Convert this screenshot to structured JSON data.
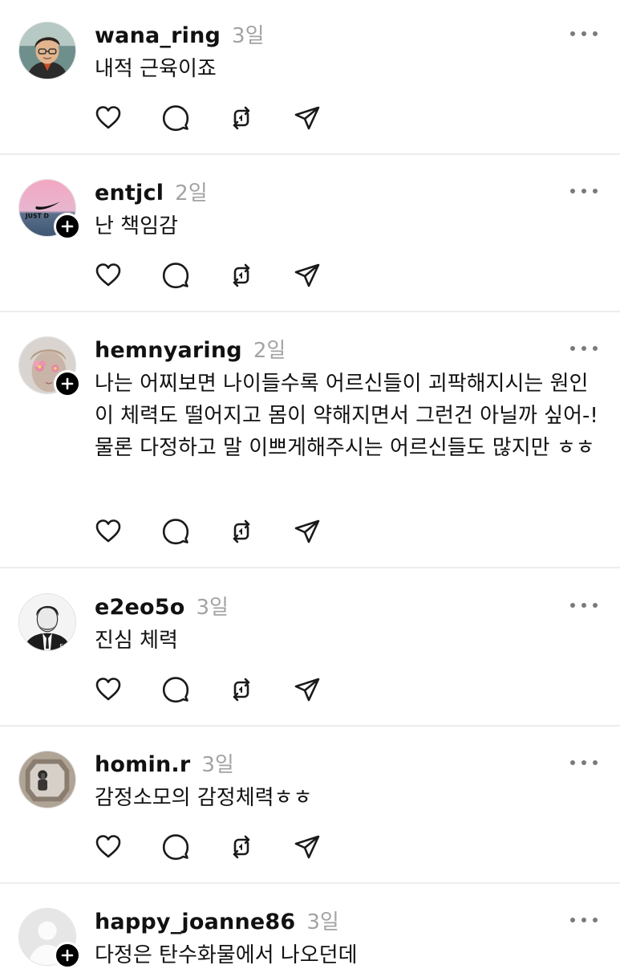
{
  "posts": [
    {
      "username": "wana_ring",
      "time": "3일",
      "text": "내적 근육이죠",
      "avatar_icon": "man-glasses-avatar",
      "follow_badge": false
    },
    {
      "username": "entjcl",
      "time": "2일",
      "text": "난 책임감",
      "avatar_icon": "pink-sky-nike-avatar",
      "avatar_text": "JUST D",
      "follow_badge": true
    },
    {
      "username": "hemnyaring",
      "time": "2일",
      "text": "나는 어찌보면 나이들수록 어르신들이 괴팍해지시는 원인이 체력도 떨어지고 몸이 약해지면서 그런건 아닐까 싶어-! 물론 다정하고 말 이쁘게해주시는 어르신들도 많지만 ㅎㅎ",
      "avatar_icon": "flower-face-avatar",
      "follow_badge": true
    },
    {
      "username": "e2eo5o",
      "time": "3일",
      "text": "진심 체력",
      "avatar_icon": "suit-man-drawing-avatar",
      "avatar_text": "EO",
      "follow_badge": false
    },
    {
      "username": "homin.r",
      "time": "3일",
      "text": "감정소모의 감정체력ㅎㅎ",
      "avatar_icon": "mirror-selfie-avatar",
      "follow_badge": false
    },
    {
      "username": "happy_joanne86",
      "time": "3일",
      "text": "다정은 탄수화물에서 나오던데",
      "avatar_icon": "default-person-avatar",
      "follow_badge": true
    }
  ],
  "actions": {
    "like": "heart-icon",
    "comment": "comment-bubble-icon",
    "repost": "repost-icon",
    "share": "send-plane-icon"
  },
  "colors": {
    "text": "#111111",
    "meta": "#a3a3a3",
    "divider": "#ededed",
    "icon": "#1a1a1a"
  }
}
